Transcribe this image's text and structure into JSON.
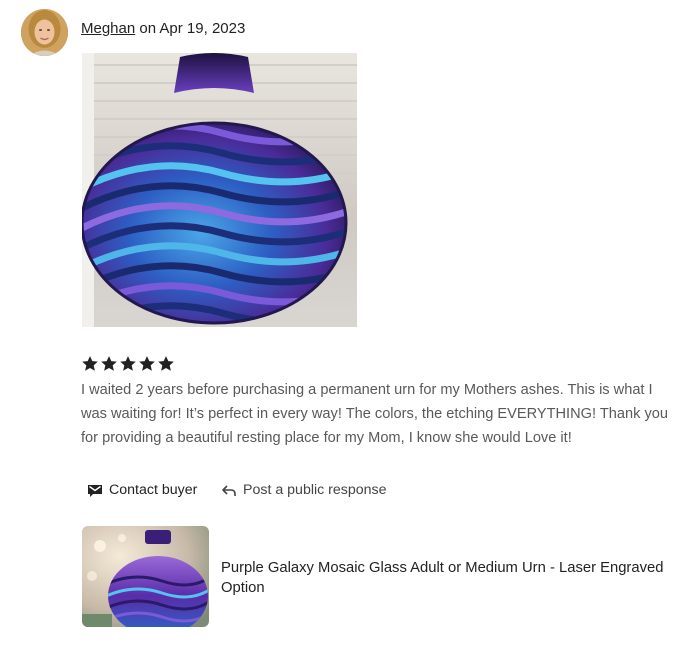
{
  "reviewer": {
    "name": "Meghan",
    "date_text": " on Apr 19, 2023"
  },
  "photo": {
    "icon": "urn-photo"
  },
  "rating": {
    "stars": 5,
    "max": 5
  },
  "review": {
    "text": "I waited 2 years before purchasing a permanent urn for my Mothers ashes. This is what I was waiting for! It’s perfect in every way! The colors, the etching EVERYTHING! Thank you for providing a beautiful resting place for my Mom, I know she would Love it!"
  },
  "actions": {
    "contact_label": "Contact buyer",
    "respond_label": "Post a public response"
  },
  "listing": {
    "title": "Purple Galaxy Mosaic Glass Adult or Medium Urn - Laser Engraved Option"
  },
  "colors": {
    "star": "#222222",
    "text_muted": "#595959",
    "urn_purple": "#5b2ca8",
    "urn_blue": "#2e7fd6"
  }
}
